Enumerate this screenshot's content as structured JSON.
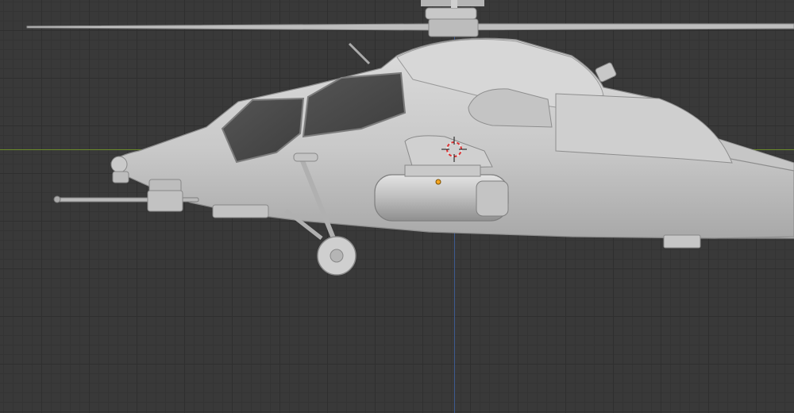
{
  "viewport": {
    "background_color": "#393939",
    "grid_color": "#2f2f2f",
    "x_axis_color": "#6b8a2a",
    "z_axis_color": "#3d5a8f"
  },
  "model": {
    "body_color": "#cfcfcf",
    "shadow_color": "#9a9a9a",
    "canopy_glass_color": "#4a4a4a"
  },
  "gizmos": {
    "cursor_icon": "3d-cursor-icon",
    "origin_color": "#f5a623"
  }
}
